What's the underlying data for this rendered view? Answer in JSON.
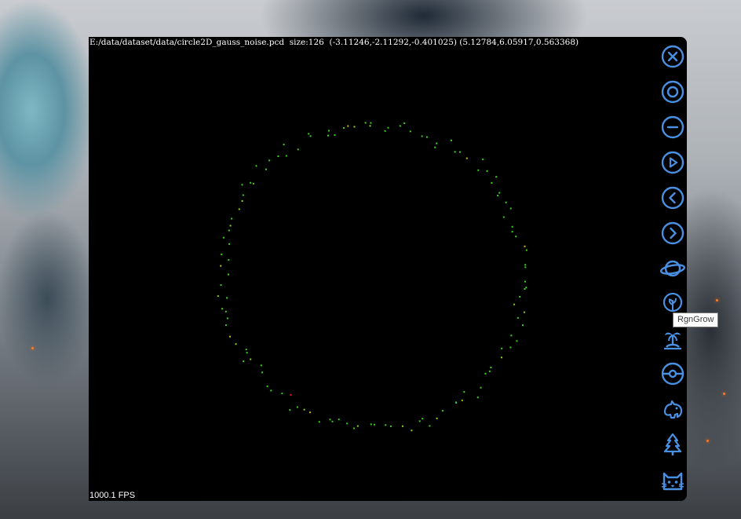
{
  "viewer": {
    "info_text": "E:/data/dataset/data/circle2D_gauss_noise.pcd  size:126  (-3.11246,-2.11292,-0.401025) (5.12784,6.05917,0.563368)",
    "fps_text": "1000.1 FPS",
    "point_cloud": {
      "file": "E:/data/dataset/data/circle2D_gauss_noise.pcd",
      "size": 126,
      "shape": "circle",
      "point_colors": [
        "#3cd21e",
        "#8ad21e",
        "#c8be1e",
        "#e61e1e",
        "#1e8ce6"
      ]
    }
  },
  "toolbar": {
    "icon_color": "#4a90e2",
    "buttons": [
      {
        "name": "close",
        "icon": "close-circle-icon"
      },
      {
        "name": "target",
        "icon": "target-circle-icon"
      },
      {
        "name": "minus",
        "icon": "minus-circle-icon"
      },
      {
        "name": "play",
        "icon": "play-circle-icon"
      },
      {
        "name": "previous",
        "icon": "chevron-left-circle-icon"
      },
      {
        "name": "next",
        "icon": "chevron-right-circle-icon"
      },
      {
        "name": "planet",
        "icon": "planet-icon"
      },
      {
        "name": "region-grow",
        "icon": "plant-circle-icon"
      },
      {
        "name": "island",
        "icon": "palm-island-icon"
      },
      {
        "name": "pokeball",
        "icon": "pokeball-icon"
      },
      {
        "name": "animal",
        "icon": "animal-icon"
      },
      {
        "name": "tree",
        "icon": "pine-tree-icon"
      },
      {
        "name": "cat",
        "icon": "cat-icon"
      }
    ],
    "tooltip": "RgnGrow"
  }
}
